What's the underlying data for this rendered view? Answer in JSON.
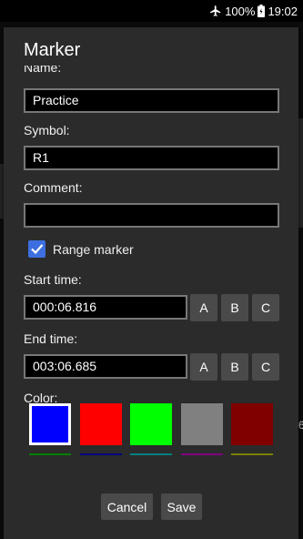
{
  "status_bar": {
    "battery_percent": "100%",
    "time": "19:02",
    "airplane_icon": "airplane-icon",
    "battery_icon": "battery-icon"
  },
  "dialog": {
    "title": "Marker",
    "name_label": "Name:",
    "name_value": "Practice",
    "symbol_label": "Symbol:",
    "symbol_value": "R1",
    "comment_label": "Comment:",
    "comment_value": "",
    "range_marker_label": "Range marker",
    "range_marker_checked": true,
    "start_time_label": "Start time:",
    "start_time_value": "000:06.816",
    "end_time_label": "End time:",
    "end_time_value": "003:06.685",
    "button_a": "A",
    "button_b": "B",
    "button_c": "C",
    "color_label": "Color:",
    "colors": [
      "#0000ff",
      "#ff0000",
      "#00ff00",
      "#808080",
      "#800000"
    ],
    "selected_color": "#0000ff",
    "next_row_colors": [
      "#008000",
      "#000080",
      "#008080",
      "#800080",
      "#808000"
    ],
    "cancel_label": "Cancel",
    "save_label": "Save"
  },
  "background": {
    "partial_text": "6"
  }
}
